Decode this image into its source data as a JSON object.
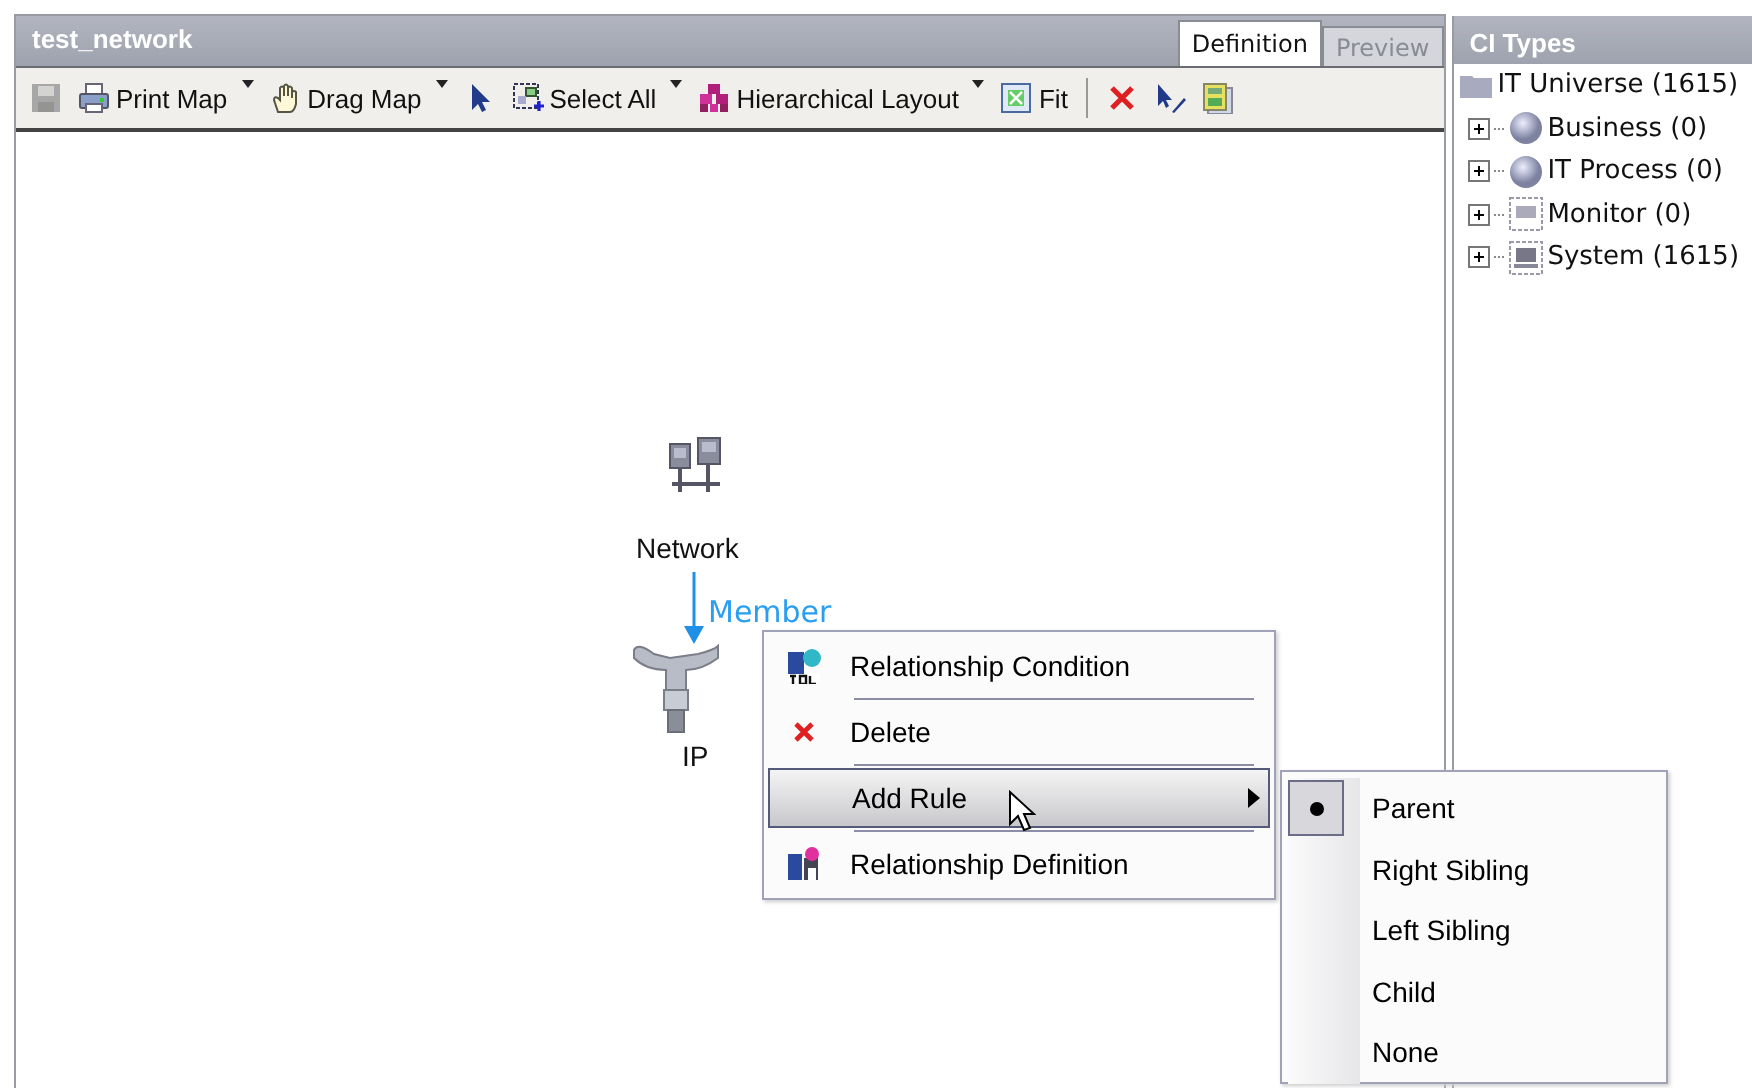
{
  "window": {
    "title": "test_network"
  },
  "tabs": [
    {
      "label": "Definition",
      "selected": true
    },
    {
      "label": "Preview",
      "selected": false
    }
  ],
  "toolbar": [
    {
      "disabled": true,
      "dropdown": false
    },
    {
      "label": "Print Map",
      "disabled": false,
      "dropdown": true
    },
    {
      "label": "Drag Map",
      "disabled": false,
      "dropdown": true
    },
    {
      "disabled": false,
      "dropdown": false
    },
    {
      "label": "Select All",
      "disabled": false,
      "dropdown": true
    },
    {
      "label": "Hierarchical Layout",
      "disabled": false,
      "dropdown": true
    },
    {
      "label": "Fit",
      "disabled": false,
      "dropdown": false
    },
    {
      "disabled": false,
      "dropdown": false
    },
    {
      "disabled": false,
      "dropdown": false
    },
    {
      "disabled": false,
      "dropdown": false
    }
  ],
  "diagram": {
    "nodes": [
      {
        "label": "Network"
      },
      {
        "label": "IP"
      }
    ],
    "edges": [
      {
        "label": "Member"
      }
    ]
  },
  "context_menu": {
    "items": [
      {
        "label": "Relationship Condition",
        "selected": false,
        "submenu": false
      },
      {
        "label": "Delete",
        "selected": false,
        "submenu": false
      },
      {
        "label": "Add Rule",
        "selected": true,
        "submenu": true
      },
      {
        "label": "Relationship Definition",
        "selected": false,
        "submenu": false
      }
    ]
  },
  "submenu": {
    "items": [
      {
        "label": "Parent",
        "checked": true
      },
      {
        "label": "Right Sibling",
        "checked": false
      },
      {
        "label": "Left Sibling",
        "checked": false
      },
      {
        "label": "Child",
        "checked": false
      },
      {
        "label": "None",
        "checked": false
      }
    ]
  },
  "sidebar": {
    "title": "CI Types",
    "tree": [
      {
        "label": "IT Universe (1615)",
        "expanded": true,
        "children": [
          {
            "label": "Business (0)",
            "expanded": false
          },
          {
            "label": "IT Process (0)",
            "expanded": false
          },
          {
            "label": "Monitor (0)",
            "expanded": false
          },
          {
            "label": "System (1615)",
            "expanded": false
          }
        ]
      }
    ]
  }
}
